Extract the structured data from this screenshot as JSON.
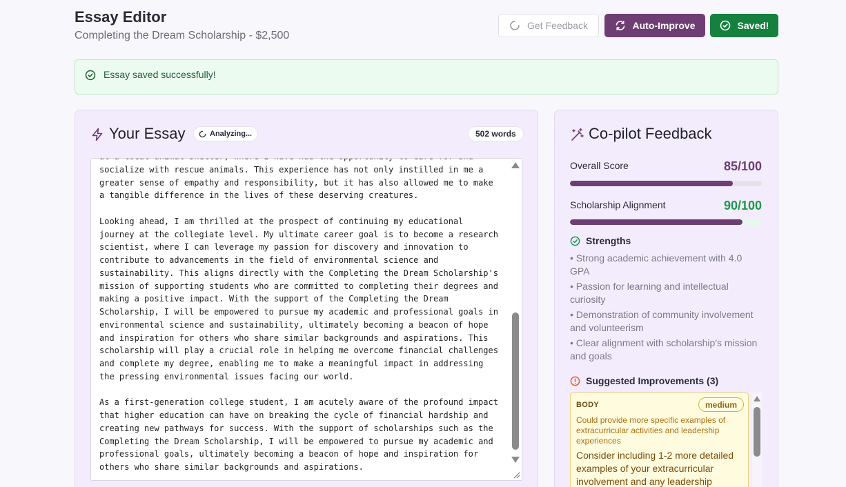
{
  "header": {
    "title": "Essay Editor",
    "subtitle": "Completing the Dream Scholarship - $2,500"
  },
  "actions": {
    "get_feedback": "Get Feedback",
    "auto_improve": "Auto-Improve",
    "saved": "Saved!"
  },
  "alert": {
    "message": "Essay saved successfully!"
  },
  "essay": {
    "title": "Your Essay",
    "status": "Analyzing...",
    "word_count": "502 words",
    "text": "at a local animal shelter, where I have had the opportunity to care for and\nsocialize with rescue animals. This experience has not only instilled in me a\ngreater sense of empathy and responsibility, but it has also allowed me to make\na tangible difference in the lives of these deserving creatures.\n\nLooking ahead, I am thrilled at the prospect of continuing my educational\njourney at the collegiate level. My ultimate career goal is to become a research\nscientist, where I can leverage my passion for discovery and innovation to\ncontribute to advancements in the field of environmental science and\nsustainability. This aligns directly with the Completing the Dream Scholarship's\nmission of supporting students who are committed to completing their degrees and\nmaking a positive impact. With the support of the Completing the Dream\nScholarship, I will be empowered to pursue my academic and professional goals in\nenvironmental science and sustainability, ultimately becoming a beacon of hope\nand inspiration for others who share similar backgrounds and aspirations. This\nscholarship will play a crucial role in helping me overcome financial challenges\nand complete my degree, enabling me to make a meaningful impact in addressing\nthe pressing environmental issues facing our world.\n\nAs a first-generation college student, I am acutely aware of the profound impact\nthat higher education can have on breaking the cycle of financial hardship and\ncreating new pathways for success. With the support of scholarships such as the\nCompleting the Dream Scholarship, I will be empowered to pursue my academic and\nprofessional goals, ultimately becoming a beacon of hope and inspiration for\nothers who share similar backgrounds and aspirations."
  },
  "copilot": {
    "title": "Co-pilot Feedback",
    "overall": {
      "label": "Overall Score",
      "value": "85/100",
      "fraction": 0.85,
      "color": "#6e3d73"
    },
    "alignment": {
      "label": "Scholarship Alignment",
      "value": "90/100",
      "fraction": 0.9,
      "color": "#1e9a4b"
    },
    "strengths_title": "Strengths",
    "strengths": [
      "• Strong academic achievement with 4.0 GPA",
      "• Passion for learning and intellectual curiosity",
      "• Demonstration of community involvement and volunteerism",
      "• Clear alignment with scholarship's mission and goals"
    ],
    "improvements_title": "Suggested Improvements (3)",
    "improvements": [
      {
        "area": "BODY",
        "severity": "medium",
        "issue": "Could provide more specific examples of extracurricular activities and leadership experiences",
        "suggestion": "Consider including 1-2 more detailed examples of your extracurricular involvement and any leadership"
      }
    ]
  },
  "colors": {
    "brand": "#6e3d73",
    "success": "#16803f",
    "warning": "#e08a12"
  }
}
